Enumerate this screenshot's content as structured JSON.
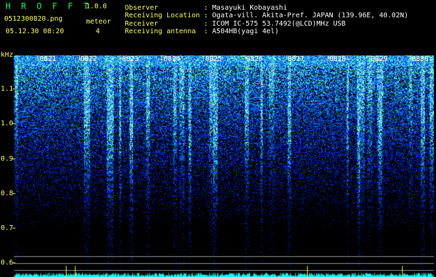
{
  "app": {
    "title": "H R O F F T",
    "version": "1.0.0",
    "filename": "0512300820.png",
    "datetime": "05.12.30 08:20",
    "meteor_label": "meteor",
    "meteor_count": "4"
  },
  "station": {
    "rows": [
      {
        "label": "Observer",
        "value": ": Masayuki Kobayashi"
      },
      {
        "label": "Receiving Location",
        "value": ": Ogata-vill. Akita-Pref. JAPAN (139.96E, 40.02N)"
      },
      {
        "label": "Receiver",
        "value": ": ICOM IC-575 53.7492(@LCD)MHz USB"
      },
      {
        "label": "Receiving antenna",
        "value": ": A504HB(yagi 4el)"
      }
    ]
  },
  "spectrogram": {
    "axis_unit": "kHz",
    "freq_ticks": [
      "1.1",
      "1.0",
      "0.9",
      "0.8",
      "0.7",
      "0.6"
    ],
    "time_ticks": [
      "0821",
      "0822",
      "0823",
      "0824",
      "0825",
      "0826",
      "0827",
      "0828",
      "0829",
      "0830"
    ],
    "colors": {
      "label": "#ffff00",
      "text": "#ffffff",
      "accent": "#ffff00",
      "bar": "#00ffff"
    }
  }
}
